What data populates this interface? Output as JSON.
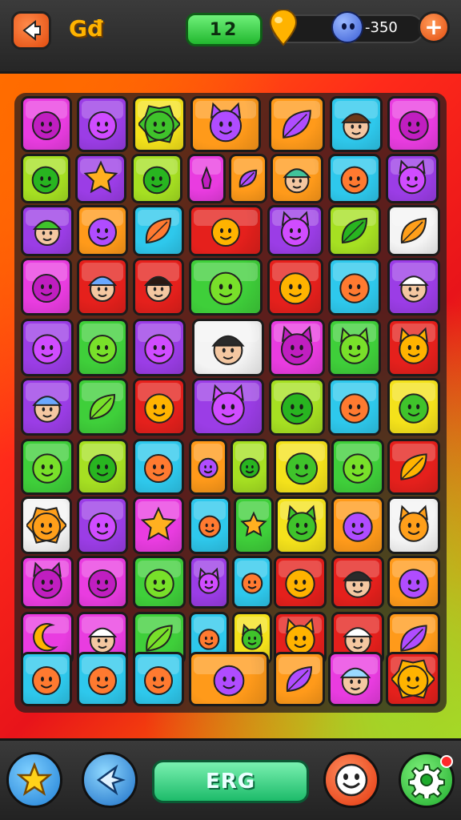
{
  "header": {
    "back_icon": "back-arrow-icon",
    "currency_label": "Gđ",
    "level": "12",
    "coin_icon": "coin-drop-icon",
    "gem_icon": "gem-creature-icon",
    "gem_count": "-350",
    "plus_label": "+"
  },
  "board": {
    "theme_colors": {
      "pink": "#e93ce0",
      "purple": "#9b3de6",
      "yellow": "#f4e21b",
      "orange": "#ff9a1a",
      "green": "#3fcf3a",
      "lime": "#a6e022",
      "cyan": "#2ec8ec",
      "red": "#e5201c",
      "white": "#f4f4f4"
    },
    "rows": [
      [
        "ghost-icon",
        "hooded-creature-icon",
        "sun-creature-icon",
        "cat-creature-icon",
        "leaf-creature-icon",
        "monkey-face-icon",
        "blob-face-icon"
      ],
      [
        "goblin-face-icon",
        "star-icon",
        "squid-icon",
        "rocket-icon",
        "feather-icon",
        "person-face-icon",
        "fish-icon",
        "bat-creature-icon"
      ],
      [
        "cap-person-icon",
        "bird-icon",
        "leaf-icon",
        "frog-icon",
        "cat-creature-icon",
        "leaf-icon",
        "carrot-icon"
      ],
      [
        "robot-icon",
        "glasses-person-icon",
        "woman-face-icon",
        "goblin-face-icon",
        "bug-icon",
        "turtle-icon",
        "chef-face-icon"
      ],
      [
        "blob-face-icon",
        "bear-face-icon",
        "blob-face-icon",
        "bandit-face-icon",
        "cat-creature-icon",
        "cat-creature-icon",
        "fox-face-icon"
      ],
      [
        "glasses-person-icon",
        "leaf-creature-icon",
        "blob-face-icon",
        "cat-creature-icon",
        "frog-creature-icon",
        "bird-creature-icon",
        "helmet-icon"
      ],
      [
        "dragon-icon",
        "tree-creature-icon",
        "pig-face-icon",
        "drop-creature-icon",
        "drop-creature-icon",
        "blob-face-icon",
        "blob-face-icon",
        "leaf-icon"
      ],
      [
        "sun-creature-icon",
        "goblin-face-icon",
        "star-creature-icon",
        "blob-face-icon",
        "star-icon",
        "cat-creature-icon",
        "blob-face-icon",
        "cat-creature-icon"
      ],
      [
        "cat-creature-icon",
        "blob-face-icon",
        "plant-creature-icon",
        "cat-creature-icon",
        "drop-creature-icon",
        "fish-creature-icon",
        "bandit-face-icon",
        "fish-creature-icon"
      ],
      [
        "moon-icon",
        "chef-face-icon",
        "leaf-creature-icon",
        "frog-creature-icon",
        "cat-creature-icon",
        "elf-face-icon",
        "chef-face-icon",
        "leaf-icon"
      ],
      [
        "bird-creature-icon",
        "fish-creature-icon",
        "crab-icon",
        "bush-creature-icon",
        "leaf-creature-icon",
        "beanie-person-icon",
        "sun-creature-icon",
        "candy-creature-icon"
      ]
    ]
  },
  "footer": {
    "star_icon": "star-icon",
    "hint_icon": "chevron-star-icon",
    "play_label": "ERG",
    "smile_icon": "smile-face-icon",
    "gear_icon": "gear-icon"
  }
}
